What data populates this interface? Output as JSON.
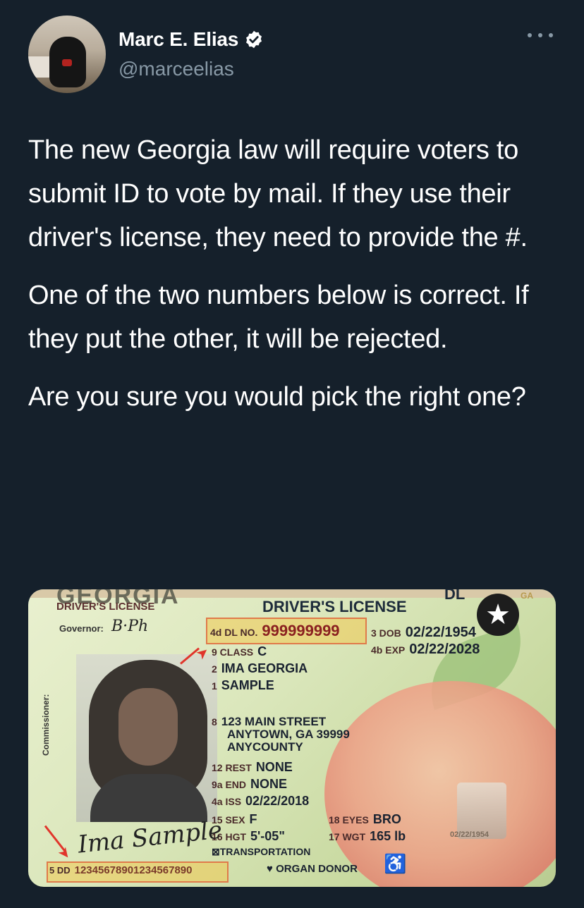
{
  "author": {
    "name": "Marc E. Elias",
    "handle": "@marceelias"
  },
  "icons": {
    "verified": "verified-badge-icon",
    "more": "more-options-icon"
  },
  "tweet": {
    "paragraphs": [
      "The new Georgia law will require voters to submit ID to vote by mail. If they use their driver's license, they need to provide the #.",
      "One of the two numbers below is correct. If they put the other, it will be rejected.",
      "Are you sure you would pick the right one?"
    ]
  },
  "license": {
    "state_title": "GEORGIA",
    "type_left": "DRIVER'S LICENSE",
    "type_center": "DRIVER'S LICENSE",
    "dl_badge": "DL",
    "corner": "GA",
    "governor_label": "Governor:",
    "commissioner_label": "Commissioner:",
    "dl_no_key": "4d DL NO.",
    "dl_no": "999999999",
    "dob_key": "3 DOB",
    "dob": "02/22/1954",
    "exp_key": "4b EXP",
    "exp": "02/22/2028",
    "class_key": "9 CLASS",
    "class": "C",
    "name2_key": "2",
    "name2": "IMA GEORGIA",
    "name1_key": "1",
    "name1": "SAMPLE",
    "addr_key": "8",
    "addr1": "123 MAIN STREET",
    "addr2": "ANYTOWN, GA 39999",
    "addr3": "ANYCOUNTY",
    "rest_key": "12 REST",
    "rest": "NONE",
    "end_key": "9a END",
    "end": "NONE",
    "iss_key": "4a ISS",
    "iss": "02/22/2018",
    "sex_key": "15 SEX",
    "sex": "F",
    "eyes_key": "18 EYES",
    "eyes": "BRO",
    "hgt_key": "16 HGT",
    "hgt": "5'-05\"",
    "wgt_key": "17 WGT",
    "wgt": "165 lb",
    "transport": "⊠TRANSPORTATION",
    "organ": "♥ ORGAN DONOR",
    "dd_key": "5 DD",
    "dd": "12345678901234567890",
    "signature": "Ima Sample",
    "ghost_date": "02/22/1954",
    "accent_highlight": "#e07a4a",
    "arrow_color": "#e0352b"
  }
}
